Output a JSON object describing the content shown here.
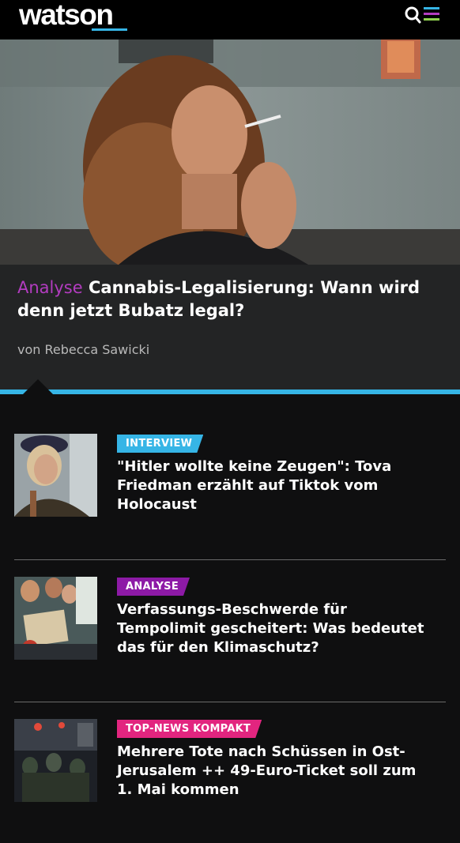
{
  "header": {
    "logo": "watson",
    "menu_icon": "search-menu-icon"
  },
  "hero": {
    "image": "woman-smoking-photo",
    "kicker": "Analyse",
    "title": "Cannabis-Legalisierung: Wann wird denn jetzt Bubatz legal?",
    "author": "von Rebecca Sawicki"
  },
  "articles": [
    {
      "tag": "INTERVIEW",
      "tag_color": "#36b5e6",
      "title": "\"Hitler wollte keine Zeugen\": Tova Friedman erzählt auf Tiktok vom Holocaust",
      "image": "elderly-woman-portrait"
    },
    {
      "tag": "ANALYSE",
      "tag_color": "#8d1aa6",
      "title": "Verfassungs-Beschwerde für Tempolimit gescheitert: Was bedeutet das für den Klimaschutz?",
      "image": "climate-protest-photo"
    },
    {
      "tag": "TOP-NEWS KOMPAKT",
      "tag_color": "#e2257f",
      "title": "Mehrere Tote nach Schüssen in Ost-Jerusalem ++ 49-Euro-Ticket soll zum 1. Mai kommen",
      "image": "police-night-scene"
    }
  ],
  "colors": {
    "accent_blue": "#36b5e6",
    "accent_purple": "#b33cc0",
    "background": "#0f0f10"
  }
}
